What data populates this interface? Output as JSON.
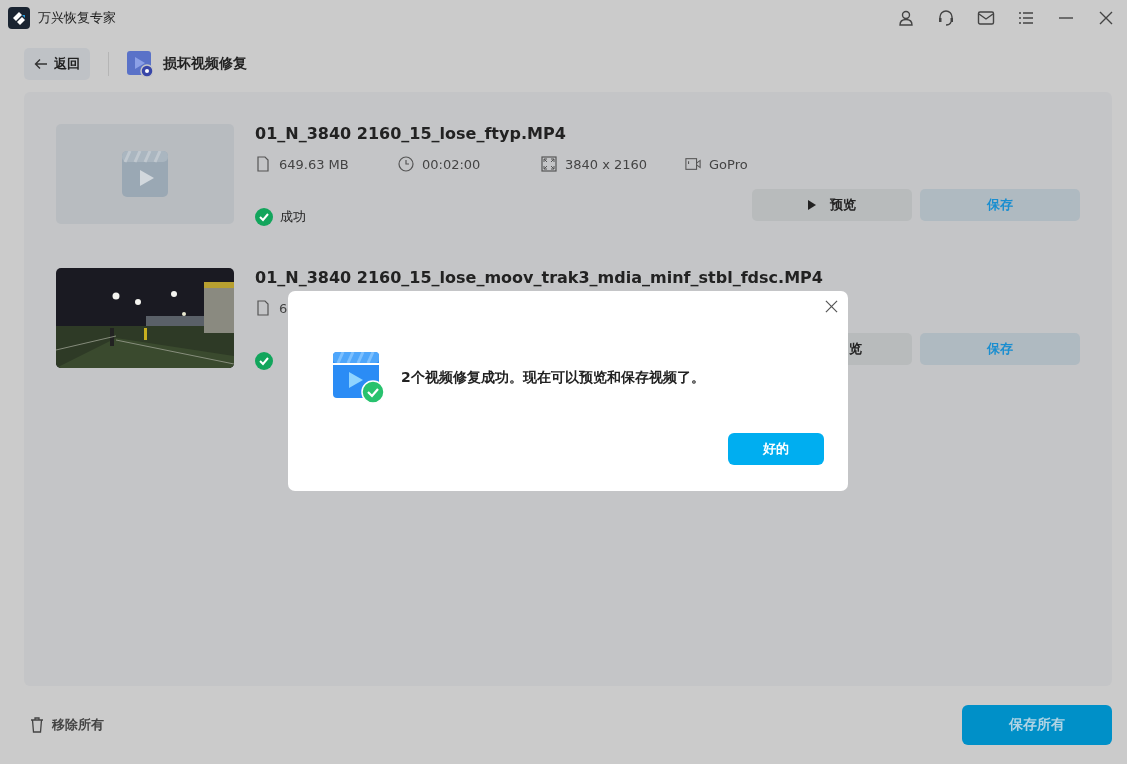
{
  "window": {
    "title": "万兴恢复专家"
  },
  "toolbar": {
    "back": "返回",
    "section": "损坏视频修复"
  },
  "videos": [
    {
      "kind": "picture-placeholder",
      "name": "01_N_3840 2160_15_lose_ftyp.MP4",
      "size": "649.63  MB",
      "duration": "00:02:00",
      "resolution": "3840 x 2160",
      "camera": "GoPro",
      "status": "成功",
      "preview": "预览",
      "save": "保存"
    },
    {
      "kind": "picture",
      "name": "01_N_3840 2160_15_lose_moov_trak3_mdia_minf_stbl_fdsc.MP4",
      "size": "6",
      "preview": "览",
      "save": "保存"
    }
  ],
  "dialog": {
    "message": "2个视频修复成功。现在可以预览和保存视频了。",
    "ok": "好的"
  },
  "footer": {
    "remove_all": "移除所有",
    "save_all": "保存所有"
  }
}
